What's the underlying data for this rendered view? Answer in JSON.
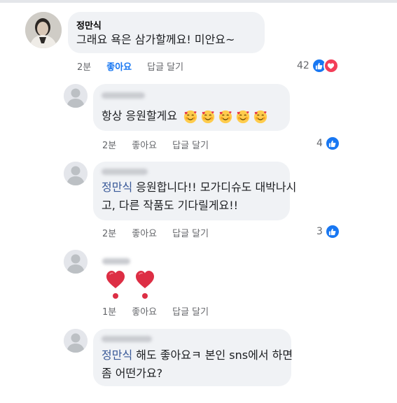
{
  "comments": [
    {
      "author": "정만식",
      "text": "그래요 욕은 삼가할께요! 미안요~",
      "time": "2분",
      "like_label": "좋아요",
      "reply_label": "답글 달기",
      "reaction_count": "42",
      "reactions": [
        "like-icon",
        "love-icon"
      ],
      "like_active": true
    },
    {
      "author": "",
      "text": "항상 응원할게요",
      "emojis": [
        "smiling-face-with-hearts-icon",
        "smiling-face-with-hearts-icon",
        "smiling-face-with-hearts-icon",
        "smiling-face-with-hearts-icon",
        "smiling-face-with-hearts-icon"
      ],
      "time": "2분",
      "like_label": "좋아요",
      "reply_label": "답글 달기",
      "reaction_count": "4",
      "reactions": [
        "like-icon"
      ]
    },
    {
      "author": "",
      "tag": "정만식",
      "line1": "응원합니다!! 모가디슈도 대박나시",
      "line2": "고, 다른 작품도 기다릴게요!!",
      "time": "2분",
      "like_label": "좋아요",
      "reply_label": "답글 달기",
      "reaction_count": "3",
      "reactions": [
        "like-icon"
      ]
    },
    {
      "author": "",
      "emojis": [
        "heart-exclamation-icon",
        "heart-exclamation-icon"
      ],
      "time": "1분",
      "like_label": "좋아요",
      "reply_label": "답글 달기"
    },
    {
      "author": "",
      "tag": "정만식",
      "line1": "해도 좋아요ㅋ 본인 sns에서 하면",
      "line2": "좀 어떤가요?"
    }
  ],
  "colors": {
    "bubble": "#f0f2f5",
    "tag": "#385898",
    "like_active": "#1877f2",
    "meta": "#65676b",
    "love": "#f33e58"
  }
}
